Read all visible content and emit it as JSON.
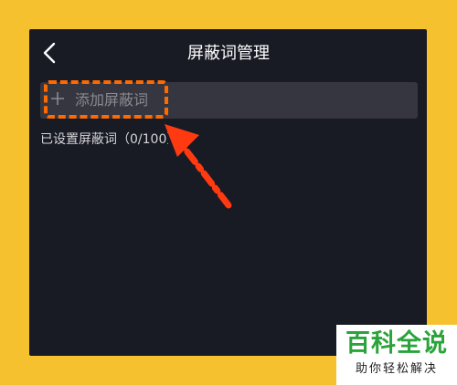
{
  "header": {
    "title": "屏蔽词管理",
    "back_icon": "chevron-left-icon"
  },
  "add_section": {
    "plus_icon": "plus-icon",
    "label": "添加屏蔽词"
  },
  "status_text": "已设置屏蔽词（0/100）",
  "colors": {
    "page_background": "#F6C12E",
    "screen_background": "#181a24",
    "input_background": "#35363f",
    "highlight": "#ff6a00",
    "arrow": "#ff3a10",
    "badge_green": "#2aa43a"
  },
  "watermark": {
    "main": "百科全说",
    "sub": "助你轻松解决"
  }
}
